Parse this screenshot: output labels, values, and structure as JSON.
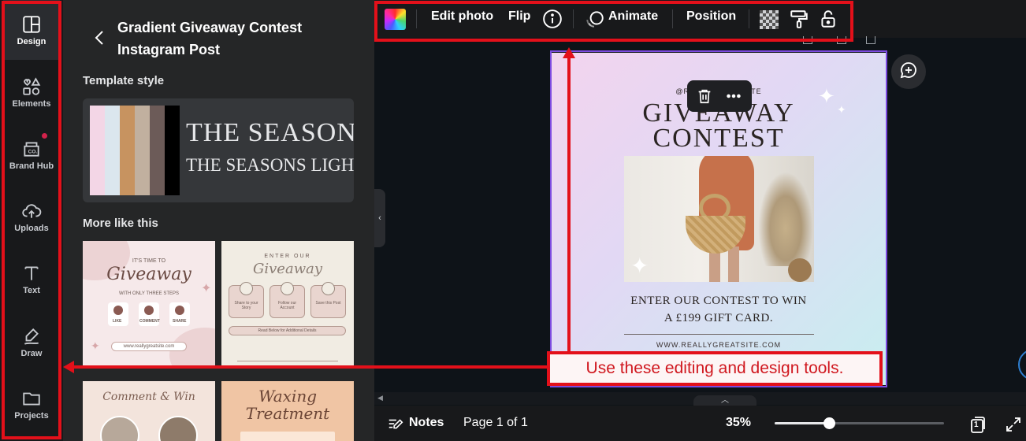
{
  "sidebar": {
    "items": [
      {
        "label": "Design",
        "icon": "layout-icon",
        "active": true
      },
      {
        "label": "Elements",
        "icon": "shapes-icon"
      },
      {
        "label": "Brand Hub",
        "icon": "brand-icon"
      },
      {
        "label": "Uploads",
        "icon": "cloud-upload-icon"
      },
      {
        "label": "Text",
        "icon": "text-icon"
      },
      {
        "label": "Draw",
        "icon": "pen-icon"
      },
      {
        "label": "Projects",
        "icon": "folder-icon"
      }
    ]
  },
  "panel": {
    "title": "Gradient Giveaway Contest Instagram Post",
    "template_style_heading": "Template style",
    "style_line1": "THE SEASON",
    "style_line2": "THE SEASONS LIGHT",
    "swatch_colors": [
      "#f3d6e6",
      "#dbe6ee",
      "#c79360",
      "#c1b09f",
      "#6c5b58",
      "#000000"
    ],
    "more_heading": "More like this",
    "thumbs": {
      "t1": {
        "kicker": "IT'S TIME TO",
        "title": "Giveaway",
        "steps": "WITH ONLY THREE STEPS",
        "labels": [
          "LIKE",
          "COMMENT",
          "SHARE"
        ],
        "url": "www.reallygreatsite.com"
      },
      "t2": {
        "kicker": "ENTER OUR",
        "title": "Giveaway",
        "cards": [
          "Share to your Story",
          "Follow our Account",
          "Save this Post"
        ],
        "note": "Read Below for Additional Details"
      },
      "t3": {
        "title": "Comment & Win"
      },
      "t4": {
        "title": "Waxing Treatment"
      }
    }
  },
  "toolbar": {
    "edit_photo": "Edit photo",
    "flip": "Flip",
    "animate": "Animate",
    "position": "Position"
  },
  "design": {
    "kicker": "@REALLYGREATSITE",
    "title1": "GIVEAWAY",
    "title2": "CONTEST",
    "line1": "ENTER OUR CONTEST TO WIN",
    "line2": "A £199 GIFT CARD.",
    "url": "WWW.REALLYGREATSITE.COM"
  },
  "annotation": {
    "callout": "Use these editing and design tools.",
    "color": "#e3101a"
  },
  "bottom": {
    "notes": "Notes",
    "page": "Page 1 of 1",
    "zoom": "35%",
    "zoom_level": 0.32,
    "page_count": "1"
  }
}
